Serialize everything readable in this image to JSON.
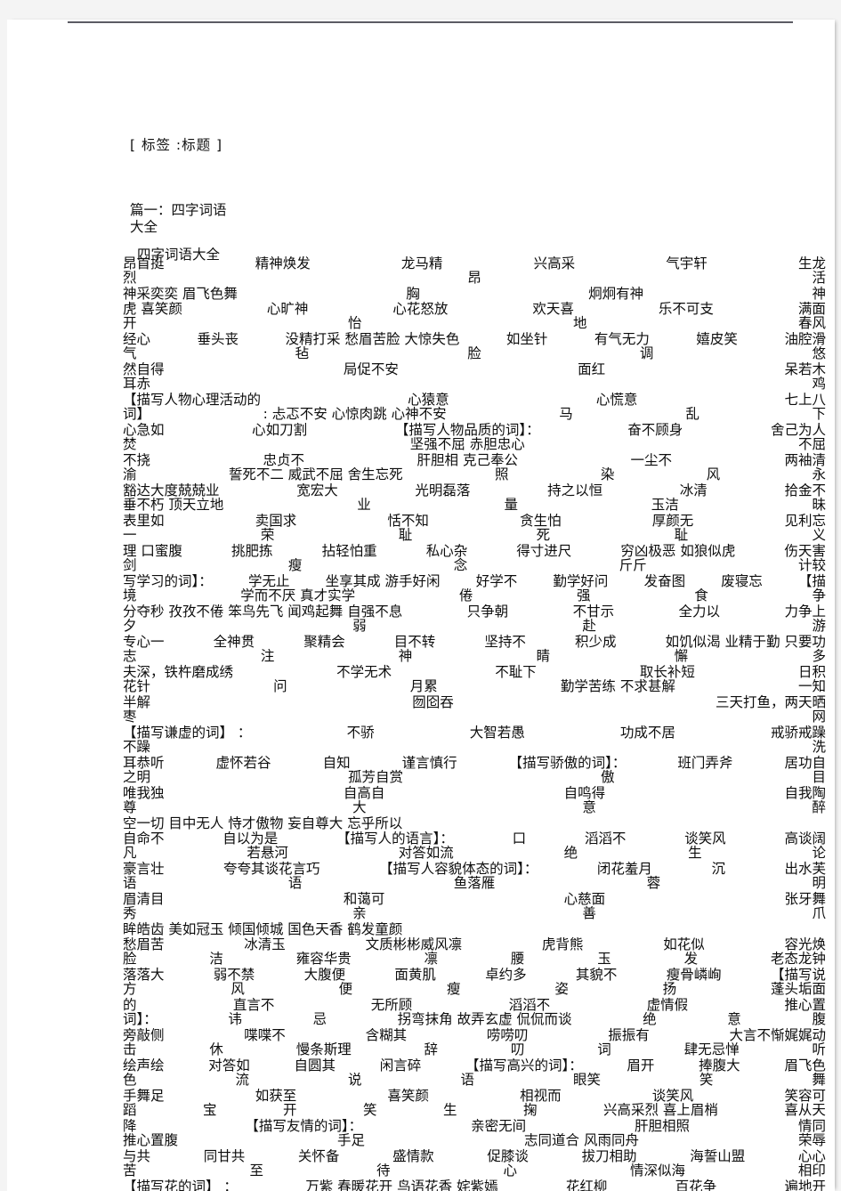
{
  "document": {
    "tag_line": "[ 标签 :标题 ]",
    "section_heading": "篇一：四字词语\n大全",
    "subtitle": "四字词语大全"
  },
  "body_rows": [
    {
      "main": [
        "昂首挺",
        "精神焕发",
        "龙马精",
        "兴高采",
        "气宇轩",
        "生龙"
      ],
      "tail": [
        "烈",
        "昂",
        "活"
      ],
      "tail_offsets": [
        430,
        560,
        660
      ]
    },
    {
      "main": [
        "神采奕奕 眉飞色舞",
        "胸",
        "炯炯有神",
        "神"
      ],
      "tail": [],
      "tail_offsets": []
    },
    {
      "main": [
        "虎 喜笑颜",
        "心旷神",
        "心花怒放",
        "欢天喜",
        "乐不可支",
        "满面"
      ],
      "tail": [
        "开",
        "怡",
        "地",
        "春风"
      ],
      "tail_offsets": [
        0,
        120,
        330,
        560
      ]
    },
    {
      "main": [
        "经心",
        "垂头丧",
        "没精打采 愁眉苦脸 大惊失色",
        "如坐针",
        "有气无力",
        "嬉皮笑",
        "油腔滑"
      ],
      "tail": [
        "气",
        "毡",
        "脸",
        "调",
        "悠"
      ],
      "tail_offsets": [
        0,
        150,
        470,
        540,
        700
      ]
    },
    {
      "main": [
        "然自得",
        "局促不安",
        "面红",
        "呆若木"
      ],
      "tail": [
        "耳赤",
        "鸡"
      ],
      "tail_offsets": [
        0,
        330
      ]
    },
    {
      "main": [
        "【描写人物心理活动的",
        "心猿意",
        "心慌意",
        "七上八"
      ],
      "tail": [
        "词】",
        ": 忐忑不安 心惊肉跳 心神不安",
        "马",
        "乱",
        "下"
      ],
      "tail_offsets": [
        0,
        0,
        0,
        0,
        0
      ]
    },
    {
      "main": [
        "心急如",
        "心如刀割",
        "【描写人物品质的词】：",
        "奋不顾身",
        "舍己为人"
      ],
      "tail": [
        "焚",
        "坚强不屈 赤胆忠心",
        "不屈"
      ],
      "tail_offsets": [
        0,
        0,
        0
      ]
    },
    {
      "main": [
        "不挠",
        "忠贞不",
        "肝胆相 克己奉公",
        "一尘不",
        "两袖清"
      ],
      "tail": [
        "渝",
        "誓死不二 威武不屈 舍生忘死",
        "照",
        "染",
        "风",
        "永"
      ],
      "tail_offsets": [
        0,
        0,
        0,
        0,
        0,
        0
      ]
    },
    {
      "main": [
        "豁达大度兢兢业",
        "宽宏大",
        "光明磊落",
        "持之以恒",
        "冰清",
        "拾金不"
      ],
      "tail": [
        "垂不朽 顶天立地",
        "业",
        "量",
        "玉洁",
        "昧"
      ],
      "tail_offsets": [
        0,
        0,
        0,
        0,
        0
      ]
    },
    {
      "main": [
        "表里如",
        "卖国求",
        "恬不知",
        "贪生怕",
        "厚颜无",
        "见利忘"
      ],
      "tail": [
        "一",
        "荣",
        "耻",
        "死",
        "耻",
        "义"
      ],
      "tail_offsets": [
        0,
        0,
        0,
        0,
        0,
        0
      ]
    },
    {
      "main": [
        "理 口蜜腹",
        "挑肥拣",
        "拈轻怕重",
        "私心杂",
        "得寸进尺",
        "穷凶极恶 如狼似虎",
        "伤天害"
      ],
      "tail": [
        "剑",
        "瘦",
        "念",
        "斤斤",
        "计较"
      ],
      "tail_offsets": [
        0,
        0,
        0,
        0,
        0
      ]
    },
    {
      "main": [
        "写学习的词】：",
        "学无止",
        "坐享其成 游手好闲",
        "好学不",
        "勤学好问",
        "发奋图",
        "废寝忘",
        "【描"
      ],
      "tail": [
        "境",
        "学而不厌 真才实学",
        "倦",
        "强",
        "食",
        "争"
      ],
      "tail_offsets": [
        0,
        0,
        0,
        0,
        0,
        0
      ]
    },
    {
      "main": [
        "分夺秒 孜孜不倦 笨鸟先飞 闻鸡起舞 自强不息",
        "只争朝",
        "不甘示",
        "全力以",
        "力争上"
      ],
      "tail": [
        "夕",
        "弱",
        "赴",
        "游"
      ],
      "tail_offsets": [
        0,
        0,
        0,
        0
      ]
    },
    {
      "main": [
        "专心一",
        "全神贯",
        "聚精会",
        "目不转",
        "坚持不",
        "积少成",
        "如饥似渴 业精于勤 只要功"
      ],
      "tail": [
        "志",
        "注",
        "神",
        "睛",
        "懈",
        "多"
      ],
      "tail_offsets": [
        0,
        0,
        0,
        0,
        0,
        0
      ]
    },
    {
      "main": [
        "夫深，铁杵磨成绣",
        "不学无术",
        "不耻下",
        "取长补短",
        "日积"
      ],
      "tail": [
        "花针",
        "问",
        "月累",
        "勤学苦练 不求甚解",
        "一知"
      ],
      "tail_offsets": [
        0,
        0,
        0,
        0,
        0
      ]
    },
    {
      "main": [
        "半解",
        "囫囵吞",
        "三天打鱼，两天晒"
      ],
      "tail": [
        "枣",
        "网"
      ],
      "tail_offsets": [
        0,
        0
      ]
    },
    {
      "main": [
        "【描写谦虚的词】 ：",
        "不骄",
        "大智若愚",
        "功成不居",
        "戒骄戒躁"
      ],
      "tail": [
        "不躁",
        "洗"
      ],
      "tail_offsets": [
        0,
        0
      ]
    },
    {
      "main": [
        "耳恭听",
        "虚怀若谷",
        "自知",
        "谨言慎行",
        "【描写骄傲的词】：",
        "班门弄斧",
        "居功自"
      ],
      "tail": [
        "之明",
        "孤芳自赏",
        "傲",
        "目"
      ],
      "tail_offsets": [
        0,
        0,
        0,
        0
      ]
    },
    {
      "main": [
        "唯我独",
        "自高自",
        "自鸣得",
        "自我陶"
      ],
      "tail": [
        "尊",
        "大",
        "意",
        "醉"
      ],
      "tail_offsets": [
        0,
        0,
        0,
        0
      ]
    },
    {
      "main": [
        "空一切 目中无人 恃才傲物 妄自尊大 忘乎所以"
      ],
      "tail": [],
      "tail_offsets": []
    },
    {
      "main": [
        "自命不",
        "自以为是",
        "【描写人的语言】：",
        "口",
        "滔滔不",
        "谈笑风",
        "高谈阔"
      ],
      "tail": [
        "凡",
        "若悬河",
        "对答如流",
        "绝",
        "生",
        "论"
      ],
      "tail_offsets": [
        0,
        0,
        0,
        0,
        0,
        0
      ]
    },
    {
      "main": [
        "豪言壮",
        "夸夸其谈花言巧",
        "【描写人容貌体态的词】：",
        "闭花羞月",
        "沉",
        "出水芙"
      ],
      "tail": [
        "语",
        "语",
        "鱼落雁",
        "蓉",
        "明"
      ],
      "tail_offsets": [
        0,
        0,
        0,
        0,
        0
      ]
    },
    {
      "main": [
        "眉清目",
        "和蔼可",
        "心慈面",
        "张牙舞"
      ],
      "tail": [
        "秀",
        "亲",
        "善",
        "爪"
      ],
      "tail_offsets": [
        0,
        0,
        0,
        0
      ]
    },
    {
      "main": [
        "眸皓齿 美如冠玉 倾国倾城 国色天香 鹤发童颜"
      ],
      "tail": [],
      "tail_offsets": []
    },
    {
      "main": [
        "愁眉苦",
        "冰清玉",
        "文质彬彬威风凛",
        "虎背熊",
        "如花似",
        "容光焕"
      ],
      "tail": [
        "脸",
        "洁",
        "雍容华贵",
        "凛",
        "腰",
        "玉",
        "发",
        "老态龙钟"
      ],
      "tail_offsets": [
        0,
        0,
        0,
        0,
        0,
        0,
        0,
        0
      ]
    },
    {
      "main": [
        "落落大",
        "弱不禁",
        "大腹便",
        "面黄肌",
        "卓约多",
        "其貌不",
        "瘦骨嶙峋",
        "【描写说"
      ],
      "tail": [
        "方",
        "风",
        "便",
        "瘦",
        "姿",
        "扬",
        "蓬头垢面"
      ],
      "tail_offsets": [
        0,
        0,
        0,
        0,
        0,
        0,
        0
      ]
    },
    {
      "main": [
        "的",
        "直言不",
        "无所顾",
        "滔滔不",
        "虚情假",
        "推心置"
      ],
      "tail": [
        "词】：",
        "讳",
        "忌",
        "拐弯抹角 故弄玄虚 侃侃而谈",
        "绝",
        "意",
        "腹"
      ],
      "tail_offsets": [
        0,
        0,
        0,
        0,
        0,
        0,
        0
      ]
    },
    {
      "main": [
        "旁敲侧",
        "喋喋不",
        "含糊其",
        "唠唠叨",
        "振振有",
        "大言不惭娓娓动"
      ],
      "tail": [
        "击",
        "休",
        "慢条斯理",
        "辞",
        "叨",
        "词",
        "肆无忌惮",
        "听"
      ],
      "tail_offsets": [
        0,
        0,
        0,
        0,
        0,
        0,
        0,
        0
      ]
    },
    {
      "main": [
        "绘声绘",
        "对答如",
        "自圆其",
        "闲言碎",
        "【描写高兴的词】：",
        "眉开",
        "捧腹大",
        "眉飞色"
      ],
      "tail": [
        "色",
        "流",
        "说",
        "语",
        "眼笑",
        "笑",
        "舞"
      ],
      "tail_offsets": [
        0,
        0,
        0,
        0,
        0,
        0,
        0
      ]
    },
    {
      "main": [
        "手舞足",
        "如获至",
        "喜笑颜",
        "相视而",
        "谈笑风",
        "笑容可"
      ],
      "tail": [
        "蹈",
        "宝",
        "开",
        "笑",
        "生",
        "掬",
        "兴高采烈 喜上眉梢",
        "喜从天"
      ],
      "tail_offsets": [
        0,
        0,
        0,
        0,
        0,
        0,
        0,
        0
      ]
    },
    {
      "main": [
        "降",
        "【描写友情的词】：",
        "亲密无间",
        "肝胆相照",
        "情同"
      ],
      "tail": [
        "推心置腹",
        "手足",
        "志同道合 风雨同舟",
        "荣辱"
      ],
      "tail_offsets": [
        0,
        0,
        0,
        0
      ]
    },
    {
      "main": [
        "与共",
        "同甘共",
        "关怀备",
        "盛情款",
        "促膝谈",
        "拔刀相助",
        "海誓山盟",
        "心心"
      ],
      "tail": [
        "苦",
        "至",
        "待",
        "心",
        "情深似海",
        "相印"
      ],
      "tail_offsets": [
        0,
        0,
        0,
        0,
        0,
        0
      ]
    },
    {
      "main": [
        "【描写花的词】 ：",
        "万紫 春暖花开 鸟语花香 姹紫嫣",
        "花红柳",
        "百花争",
        "遍地开"
      ],
      "tail": [],
      "tail_offsets": []
    }
  ]
}
